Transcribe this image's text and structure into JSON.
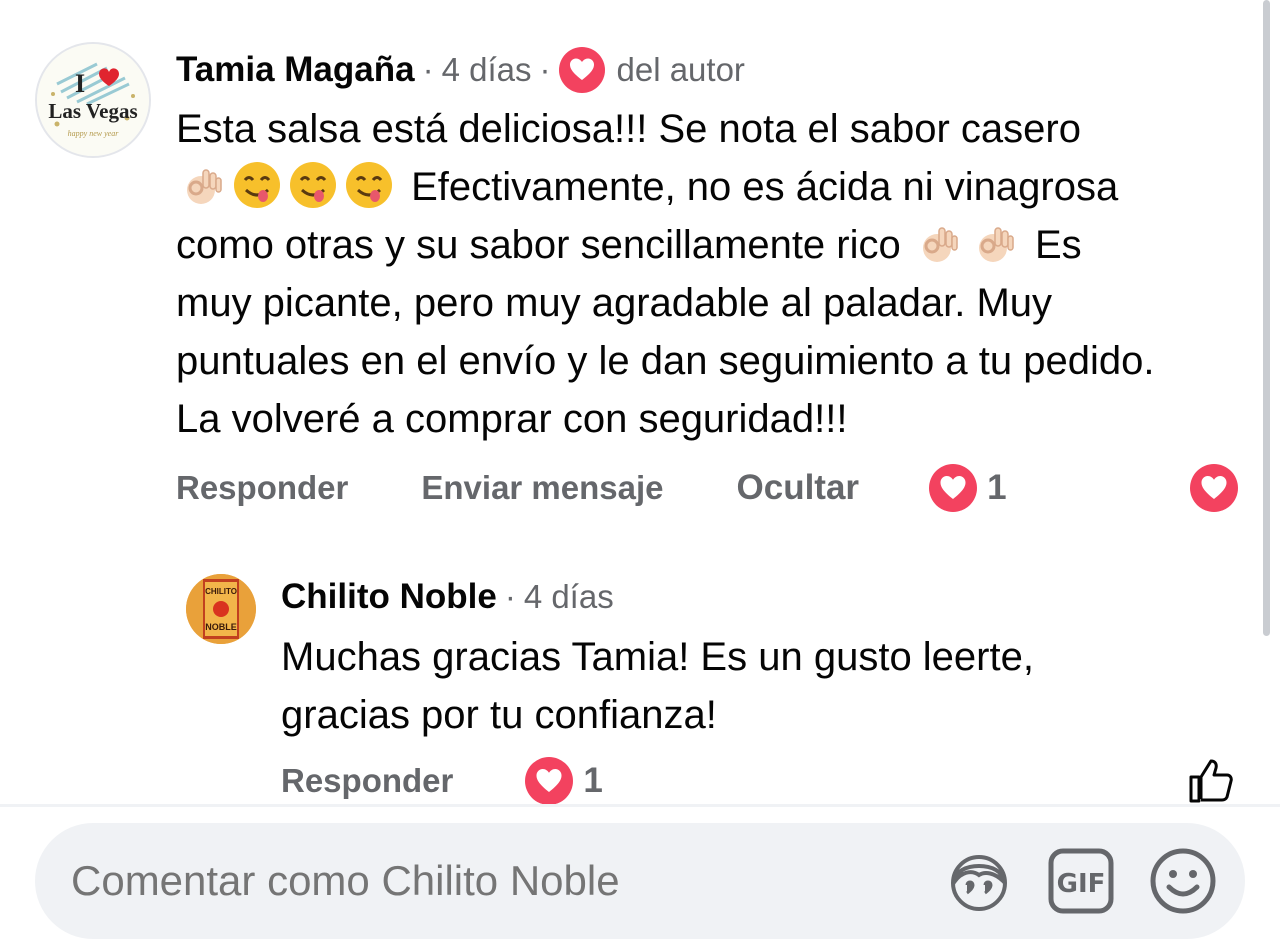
{
  "comment": {
    "author": "Tamia Magaña",
    "time": "4 días",
    "author_badge": "del autor",
    "text_line1": "Esta salsa está deliciosa!!! Se nota el sabor casero",
    "text_line2": "Efectivamente, no es ácida ni vinagrosa",
    "text_line3a": "como otras y su sabor sencillamente rico",
    "text_line3b": "Es",
    "text_rest": "muy picante, pero muy agradable al paladar. Muy puntuales en el envío y le dan seguimiento a tu pedido. La volveré a comprar con seguridad!!!",
    "avatar_text_top": "I",
    "avatar_text": "Las Vegas",
    "avatar_sub": "happy new year",
    "actions": {
      "reply": "Responder",
      "message": "Enviar mensaje",
      "hide": "Ocultar"
    },
    "reaction_count": "1"
  },
  "reply": {
    "author": "Chilito Noble",
    "time": "4 días",
    "text_line1": "Muchas gracias Tamia! Es un gusto leerte,",
    "text_line2": "gracias por tu confianza!",
    "avatar_text1": "CHILITO",
    "avatar_text2": "NOBLE",
    "actions": {
      "reply": "Responder"
    },
    "reaction_count": "1"
  },
  "composer": {
    "placeholder": "Comentar como Chilito Noble"
  },
  "icons": {
    "heart": "heart-icon",
    "ok_hand": "ok-hand-emoji",
    "yum": "yum-emoji",
    "like": "like-icon",
    "avatar_sticker": "avatar-sticker-icon",
    "gif": "gif-icon",
    "emoji": "emoji-icon"
  },
  "colors": {
    "heart_red": "#f3425f",
    "text_secondary": "#65676b",
    "composer_bg": "#f0f2f5"
  }
}
